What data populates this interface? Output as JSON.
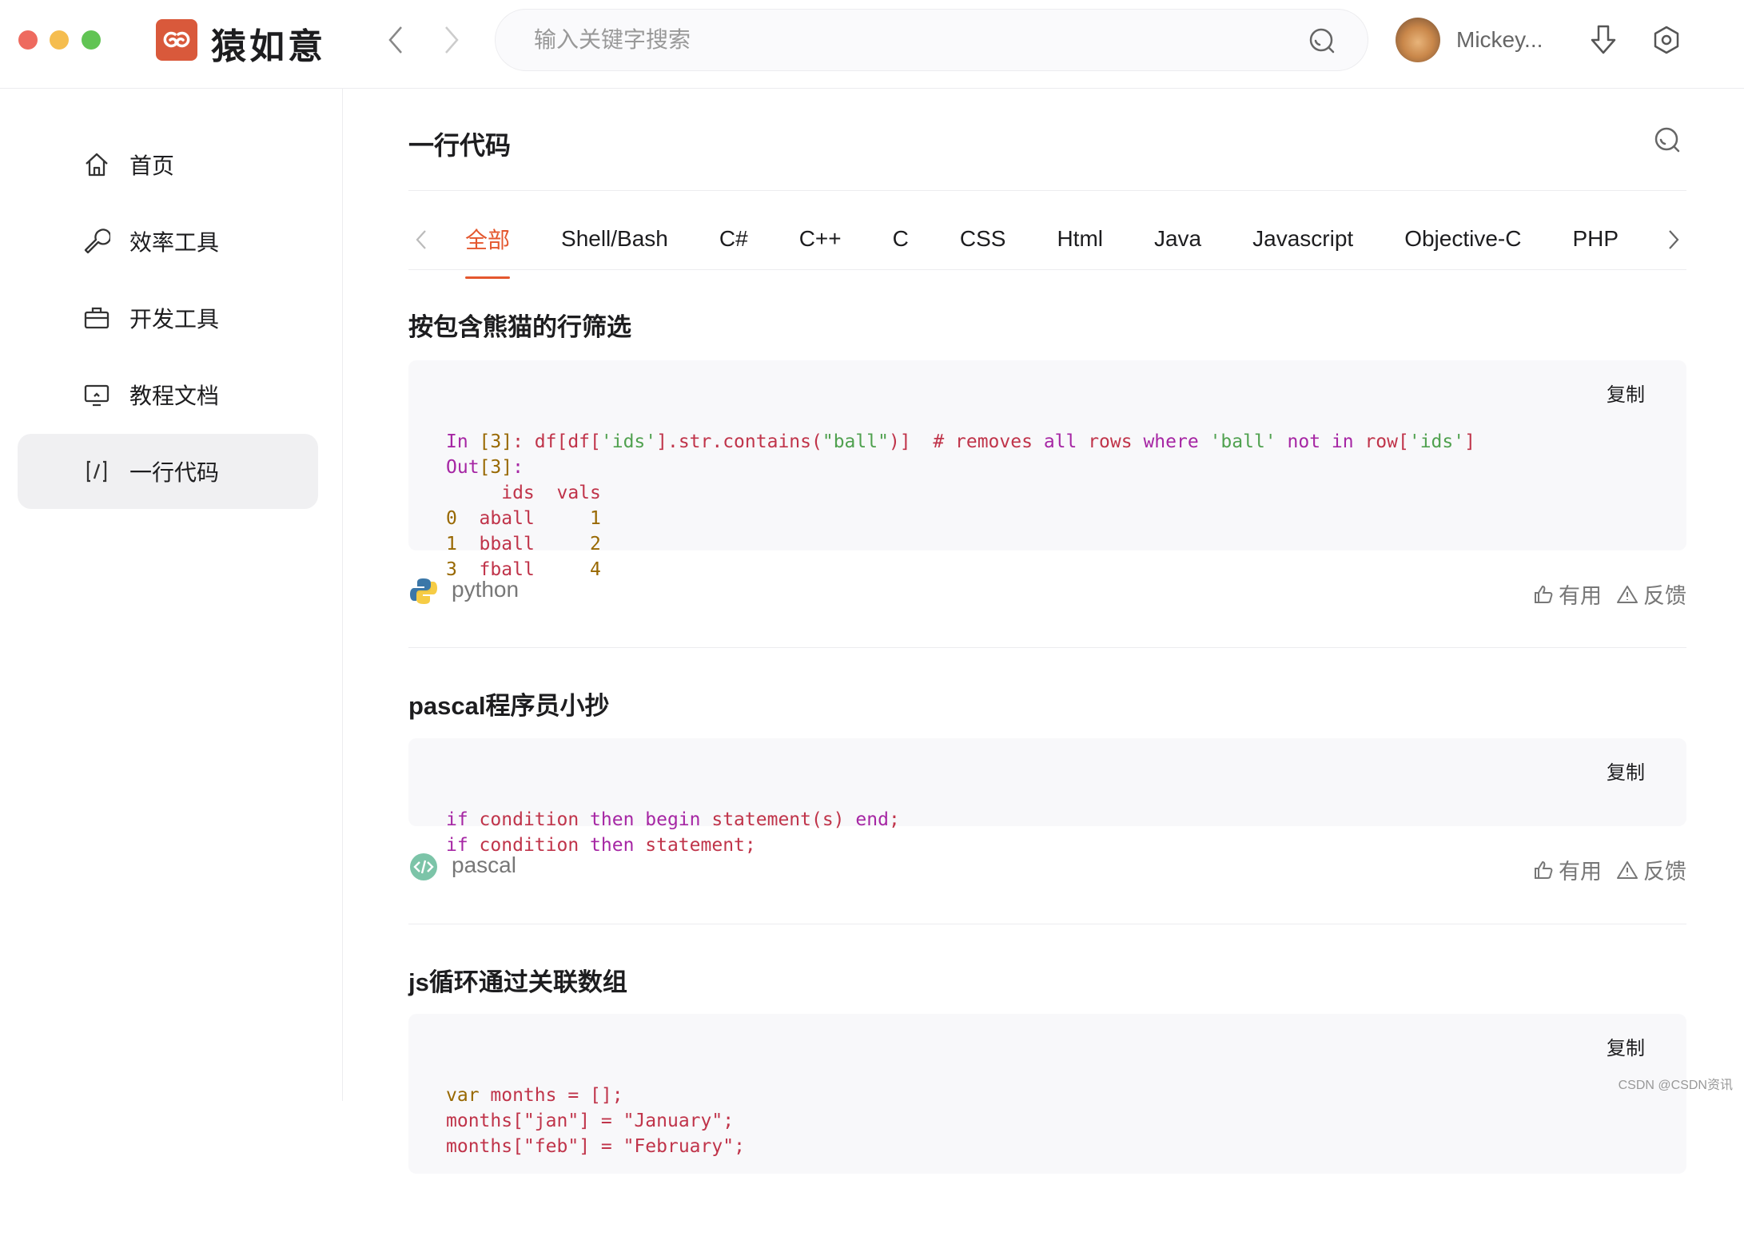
{
  "window": {
    "controls": [
      "close",
      "minimize",
      "maximize"
    ],
    "colors": {
      "close": "#ee6a5f",
      "minimize": "#f5bd4f",
      "maximize": "#61c454"
    }
  },
  "header": {
    "brand": "猿如意",
    "search_placeholder": "输入关键字搜索",
    "user_name": "Mickey...",
    "accent": "#e4572e"
  },
  "sidebar": {
    "items": [
      {
        "label": "首页",
        "icon": "home-icon"
      },
      {
        "label": "效率工具",
        "icon": "wrench-icon"
      },
      {
        "label": "开发工具",
        "icon": "briefcase-icon"
      },
      {
        "label": "教程文档",
        "icon": "monitor-icon"
      },
      {
        "label": "一行代码",
        "icon": "code-icon",
        "active": true
      }
    ]
  },
  "main": {
    "title": "一行代码",
    "tabs": [
      "全部",
      "Shell/Bash",
      "C#",
      "C++",
      "C",
      "CSS",
      "Html",
      "Java",
      "Javascript",
      "Objective-C",
      "PHP"
    ],
    "active_tab": "全部",
    "snippets": [
      {
        "title": "按包含熊猫的行筛选",
        "language": "python",
        "copy": "复制",
        "useful": "有用",
        "feedback": "反馈",
        "lines": [
          [
            [
              "In ",
              "k"
            ],
            [
              "[3]",
              "n"
            ],
            [
              ": df[df[",
              "r"
            ],
            [
              "'ids'",
              "g"
            ],
            [
              "].str.contains(",
              "r"
            ],
            [
              "\"ball\"",
              "g"
            ],
            [
              ")]  # removes ",
              "r"
            ],
            [
              "all",
              "k"
            ],
            [
              " rows ",
              "r"
            ],
            [
              "where",
              "k"
            ],
            [
              " ",
              "r"
            ],
            [
              "'ball'",
              "g"
            ],
            [
              " ",
              "r"
            ],
            [
              "not in",
              "k"
            ],
            [
              " row[",
              "r"
            ],
            [
              "'ids'",
              "g"
            ],
            [
              "]",
              "r"
            ]
          ],
          [
            [
              "Out",
              "k"
            ],
            [
              "[3]",
              "n"
            ],
            [
              ":",
              "k"
            ]
          ],
          [
            [
              "     ids  vals",
              "r"
            ]
          ],
          [
            [
              "0",
              "n"
            ],
            [
              "  aball     ",
              "r"
            ],
            [
              "1",
              "n"
            ]
          ],
          [
            [
              "1",
              "n"
            ],
            [
              "  bball     ",
              "r"
            ],
            [
              "2",
              "n"
            ]
          ],
          [
            [
              "3",
              "n"
            ],
            [
              "  fball     ",
              "r"
            ],
            [
              "4",
              "n"
            ]
          ]
        ]
      },
      {
        "title": "pascal程序员小抄",
        "language": "pascal",
        "copy": "复制",
        "useful": "有用",
        "feedback": "反馈",
        "lines": [
          [
            [
              "if",
              "k"
            ],
            [
              " condition ",
              "r"
            ],
            [
              "then begin",
              "k"
            ],
            [
              " statement(s) ",
              "r"
            ],
            [
              "end",
              "k"
            ],
            [
              ";",
              "r"
            ]
          ],
          [
            [
              "if",
              "k"
            ],
            [
              " condition ",
              "r"
            ],
            [
              "then",
              "k"
            ],
            [
              " statement;",
              "r"
            ]
          ]
        ]
      },
      {
        "title": "js循环通过关联数组",
        "copy": "复制",
        "lines": [
          [
            [
              "var",
              "n"
            ],
            [
              " months = [];",
              "r"
            ]
          ],
          [
            [
              "months[",
              "r"
            ],
            [
              "\"jan\"",
              "r"
            ],
            [
              "] = ",
              "r"
            ],
            [
              "\"January\"",
              "r"
            ],
            [
              ";",
              "r"
            ]
          ],
          [
            [
              "months[",
              "r"
            ],
            [
              "\"feb\"",
              "r"
            ],
            [
              "] = ",
              "r"
            ],
            [
              "\"February\"",
              "r"
            ],
            [
              ";",
              "r"
            ]
          ]
        ]
      }
    ]
  },
  "watermark": "CSDN @CSDN资讯"
}
